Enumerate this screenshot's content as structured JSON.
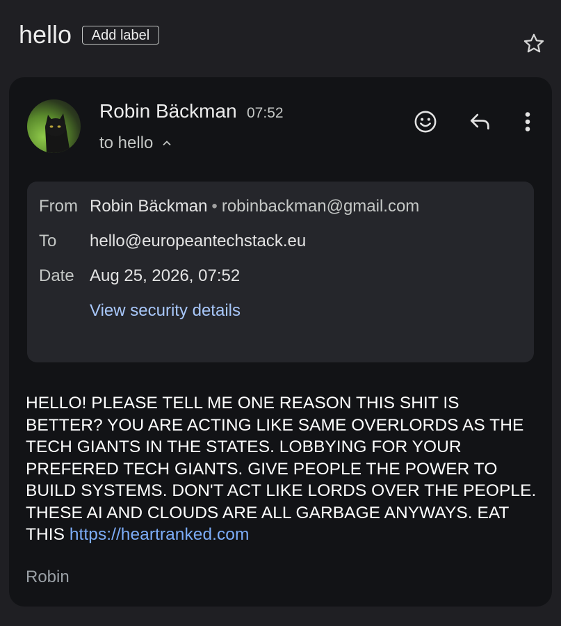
{
  "header": {
    "subject": "hello",
    "add_label": "Add label"
  },
  "message": {
    "sender_name": "Robin Bäckman",
    "time": "07:52",
    "to_summary": "to hello"
  },
  "details": {
    "from_label": "From",
    "from_name": "Robin Bäckman",
    "separator": "•",
    "from_email": "robinbackman@gmail.com",
    "to_label": "To",
    "to_value": "hello@europeantechstack.eu",
    "date_label": "Date",
    "date_value": "Aug 25, 2026, 07:52",
    "security_link": "View security details"
  },
  "body": {
    "text": "HELLO! PLEASE TELL ME ONE REASON THIS SHIT IS BETTER? YOU ARE ACTING LIKE SAME OVERLORDS AS THE TECH GIANTS IN THE STATES. LOBBYING FOR YOUR PREFERED TECH GIANTS. GIVE PEOPLE THE POWER TO BUILD SYSTEMS. DON'T ACT LIKE LORDS OVER THE PEOPLE. THESE AI AND CLOUDS ARE ALL GARBAGE ANYWAYS. EAT THIS ",
    "link": "https://heartranked.com",
    "signature": "Robin"
  },
  "icons": {
    "star": "star-outline-icon",
    "emoji": "emoji-reaction-icon",
    "reply": "reply-icon",
    "more": "more-vertical-icon",
    "chevron": "chevron-up-icon"
  },
  "colors": {
    "background": "#1f1f23",
    "card": "#121316",
    "details_panel": "#25262b",
    "link": "#a8c7fa",
    "body_link": "#7cacf8"
  }
}
